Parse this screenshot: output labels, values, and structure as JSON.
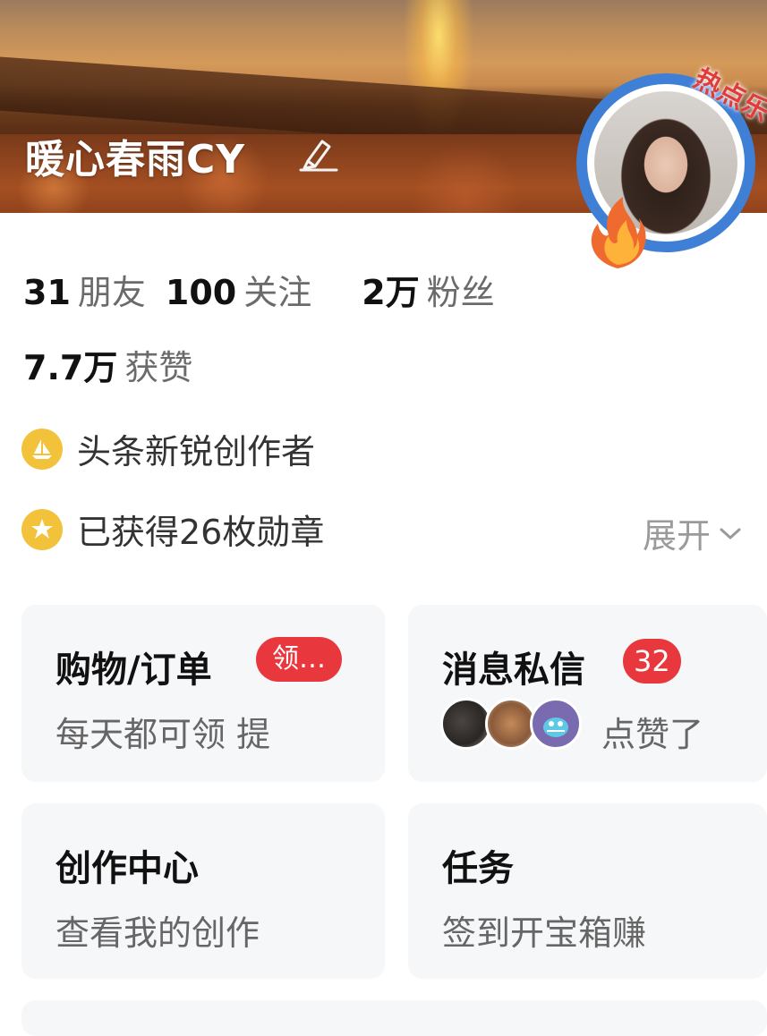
{
  "profile": {
    "name": "暖心春雨CY",
    "hot_badge": "热点乐"
  },
  "stats": [
    {
      "num": "31",
      "label": "朋友"
    },
    {
      "num": "100",
      "label": "关注"
    },
    {
      "num": "2万",
      "label": "粉丝"
    }
  ],
  "likes": {
    "num": "7.7万",
    "label": "获赞"
  },
  "creator_tag": {
    "text": "头条新锐创作者"
  },
  "medals": {
    "text": "已获得26枚勋章",
    "expand": "展开"
  },
  "cards": {
    "shopping": {
      "title": "购物/订单",
      "pill": "领…",
      "sub": "每天都可领 提"
    },
    "messages": {
      "title": "消息私信",
      "badge": "32",
      "sub": "点赞了"
    },
    "creation": {
      "title": "创作中心",
      "sub": "查看我的创作"
    },
    "tasks": {
      "title": "任务",
      "sub": "签到开宝箱赚"
    }
  },
  "colors": {
    "badge_red": "#e8383d",
    "avatar_ring": "#3f7fd6",
    "creator_icon": "#f3c23b"
  },
  "icons": {
    "edit": "pencil-icon",
    "creator": "sailboat-icon",
    "medal": "star-medal-icon",
    "expand": "chevron-down-icon"
  }
}
